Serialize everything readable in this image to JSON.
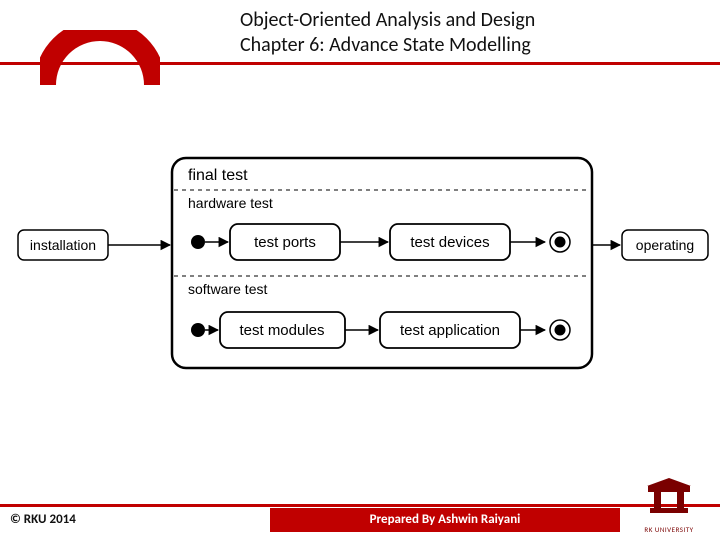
{
  "header": {
    "title_line1": "Object-Oriented Analysis and Design",
    "title_line2": "Chapter 6: Advance State Modelling"
  },
  "diagram": {
    "composite_state": "final test",
    "regions": {
      "hardware": {
        "label": "hardware test",
        "state1": "test ports",
        "state2": "test devices"
      },
      "software": {
        "label": "software test",
        "state1": "test modules",
        "state2": "test application"
      }
    },
    "entry_state": "installation",
    "exit_state": "operating"
  },
  "footer": {
    "copyright": "© RKU 2014",
    "prepared_by": "Prepared By Ashwin Raiyani",
    "logo_text": "RK UNIVERSITY"
  },
  "chart_data": {
    "type": "state-diagram",
    "initial": "installation",
    "final": "operating",
    "composite": {
      "name": "final test",
      "concurrent_regions": [
        {
          "name": "hardware test",
          "sequence": [
            "(initial)",
            "test ports",
            "test devices",
            "(final)"
          ]
        },
        {
          "name": "software test",
          "sequence": [
            "(initial)",
            "test modules",
            "test application",
            "(final)"
          ]
        }
      ]
    },
    "transitions": [
      {
        "from": "installation",
        "to": "final test"
      },
      {
        "from": "final test",
        "to": "operating"
      }
    ]
  }
}
